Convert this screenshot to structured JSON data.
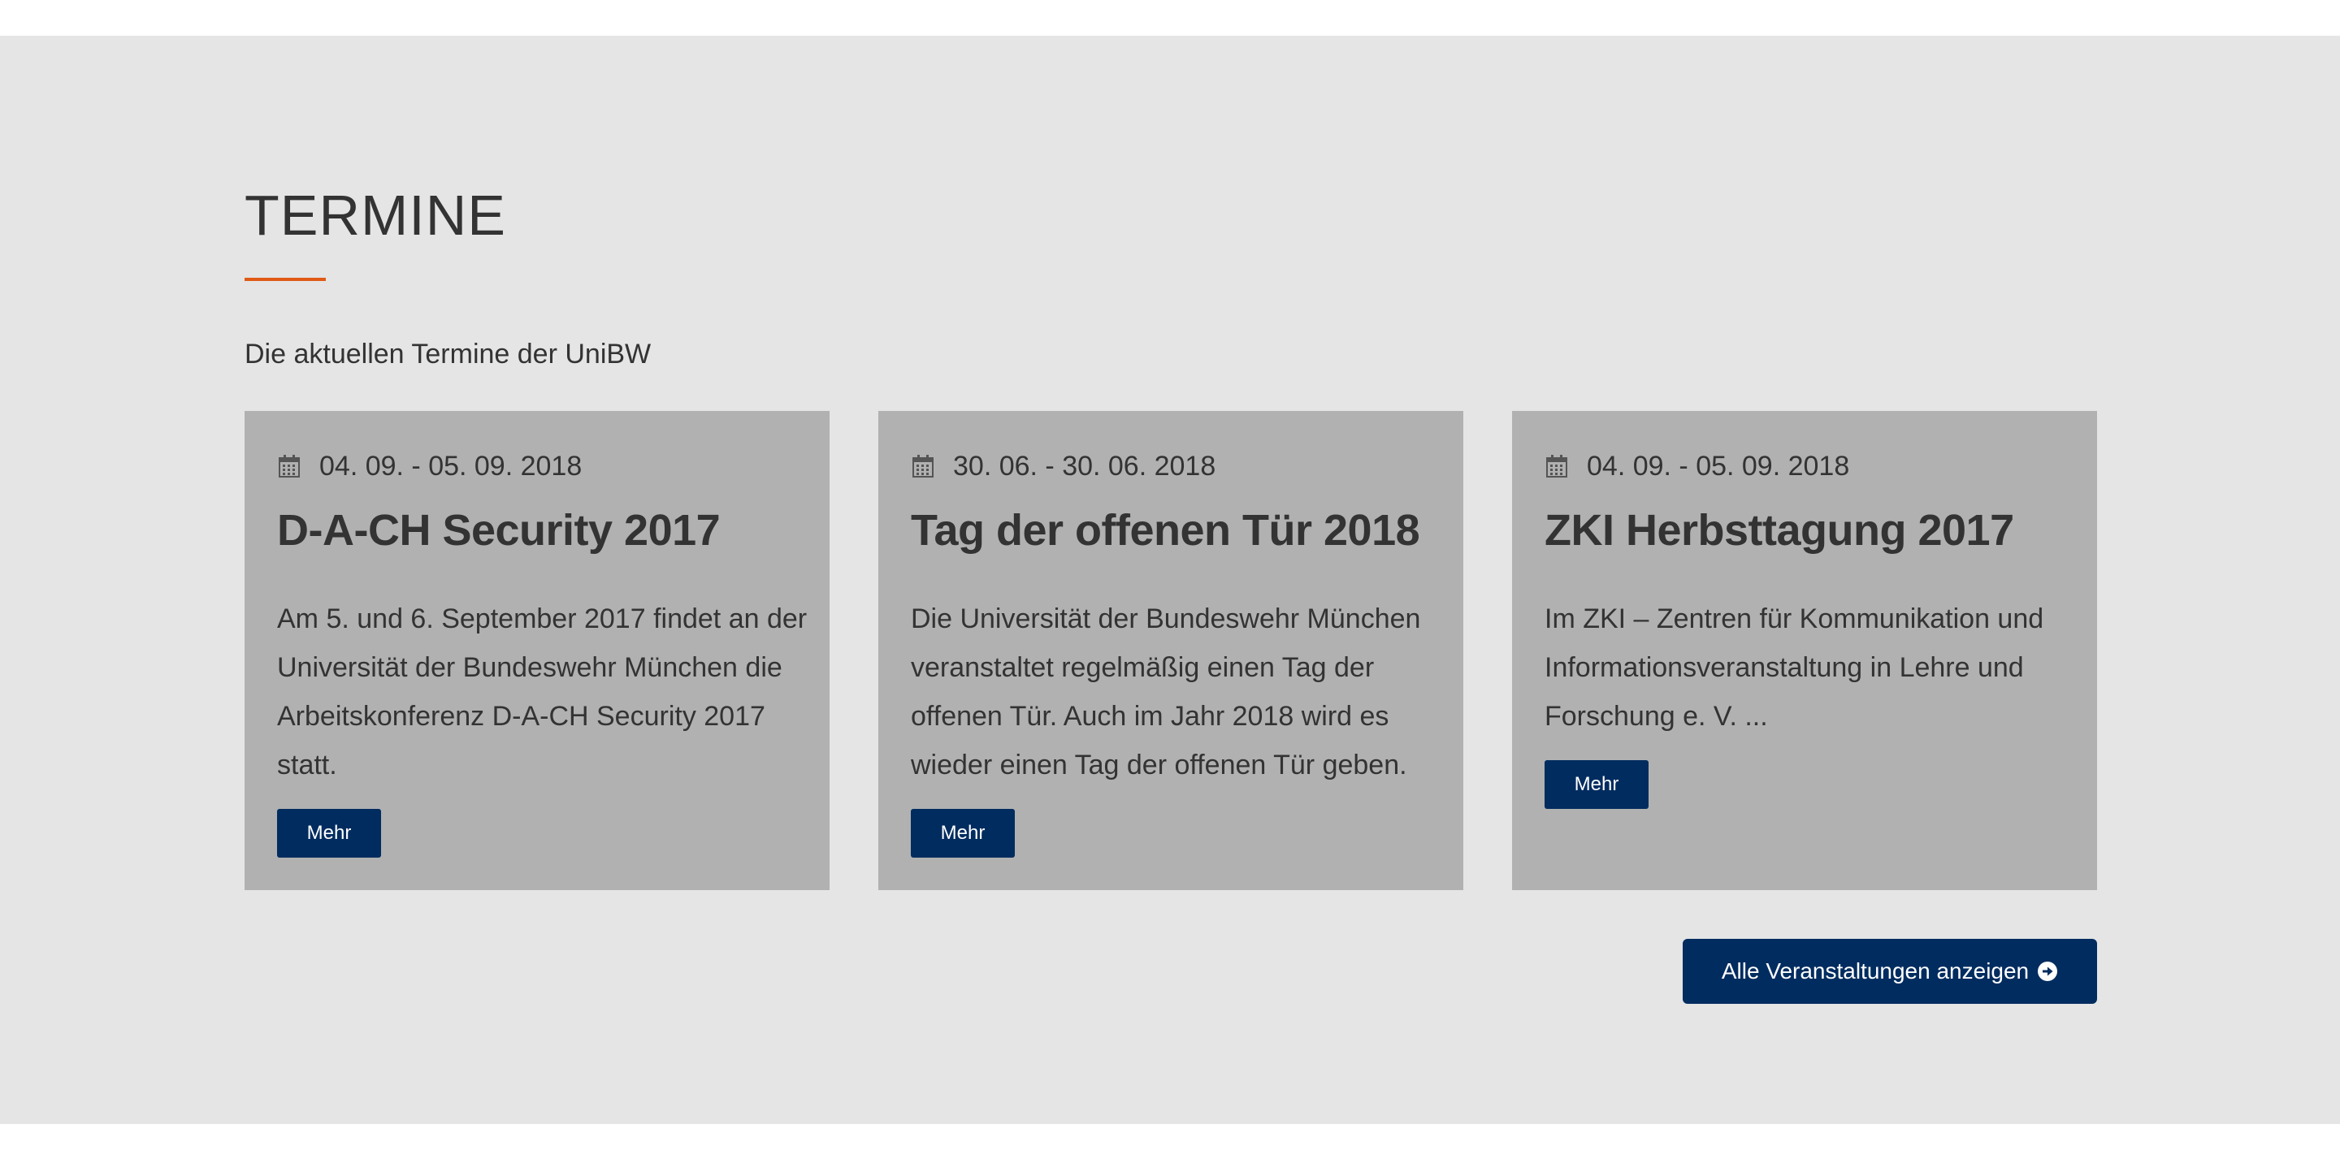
{
  "section": {
    "title": "TERMINE",
    "subtitle": "Die aktuellen Termine der UniBW",
    "accent_color": "#e05a17",
    "button_color": "#002c5f"
  },
  "cards": [
    {
      "date": "04. 09. - 05. 09. 2018",
      "title": "D-A-CH Security 2017",
      "text": "Am 5. und 6. September 2017 findet an der Universität der Bundeswehr München die Arbeitskonferenz D-A-CH Security 2017 statt.",
      "button_label": "Mehr",
      "icon": "calendar-icon"
    },
    {
      "date": "30. 06. - 30. 06. 2018",
      "title": "Tag der offenen Tür 2018",
      "text": "Die Universität der Bundeswehr München veranstaltet regelmäßig einen Tag der offenen Tür. Auch im Jahr 2018 wird es wieder einen Tag der offenen Tür geben.",
      "button_label": "Mehr",
      "icon": "calendar-icon"
    },
    {
      "date": "04. 09. - 05. 09. 2018",
      "title": "ZKI Herbsttagung 2017",
      "text": "Im ZKI – Zentren für Kommunikation und Informationsveranstaltung in Lehre und Forschung e. V. ...",
      "button_label": "Mehr",
      "icon": "calendar-icon"
    }
  ],
  "all_events": {
    "label": "Alle Veranstaltungen anzeigen",
    "icon": "arrow-circle-right-icon"
  }
}
